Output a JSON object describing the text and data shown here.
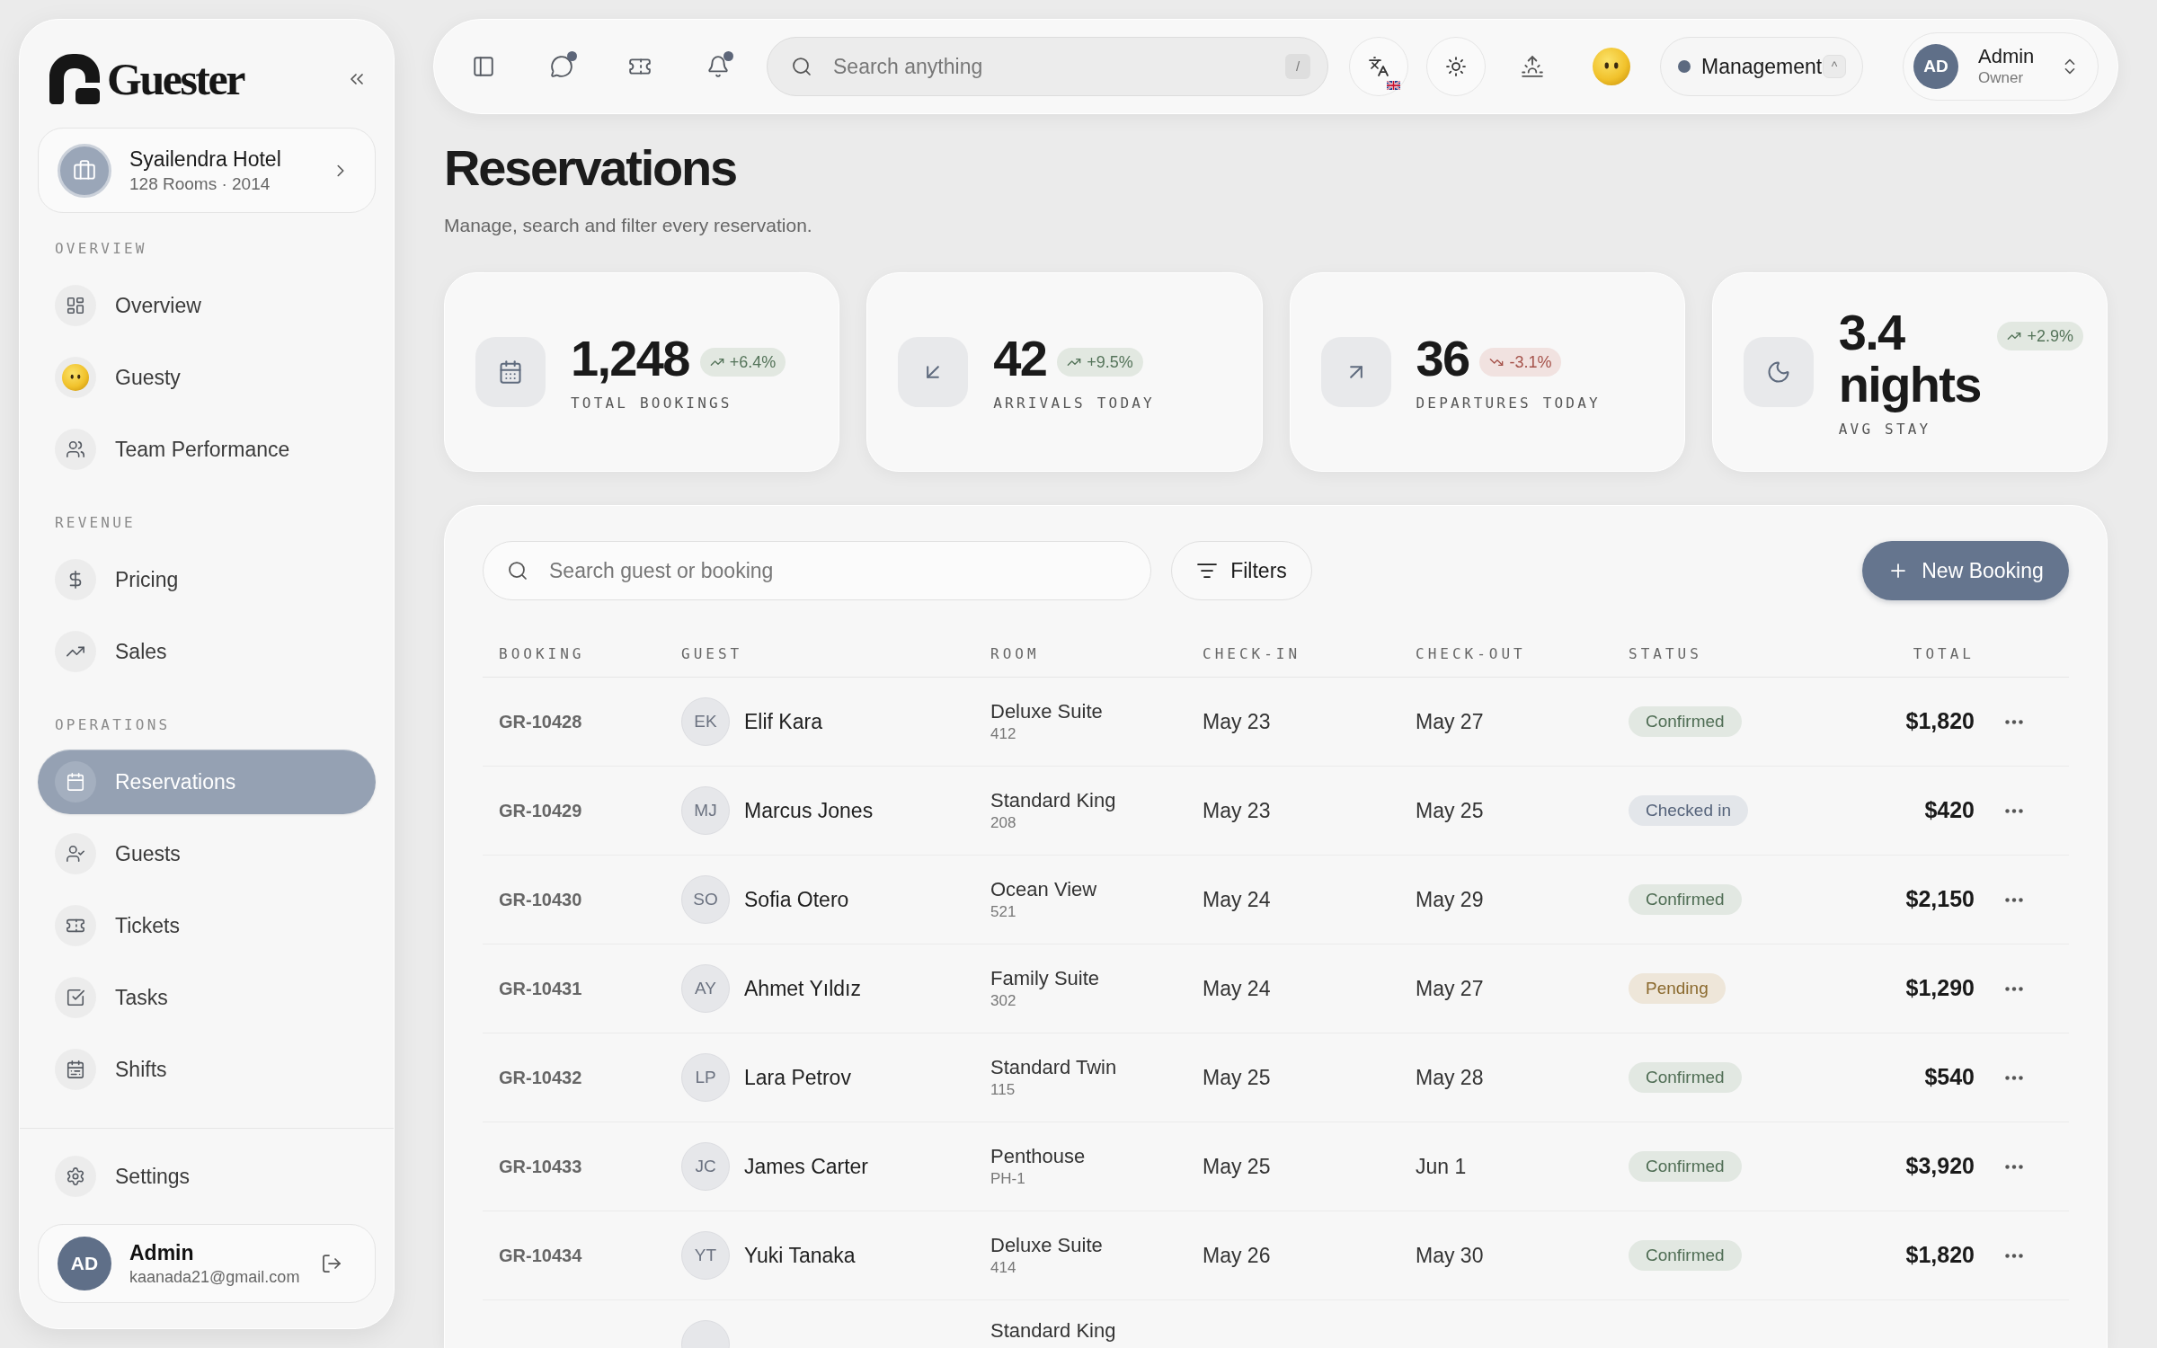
{
  "sidebar": {
    "brand": "Guester",
    "hotel": {
      "name": "Syailendra Hotel",
      "meta": "128 Rooms · 2014"
    },
    "sections": [
      {
        "title": "OVERVIEW",
        "items": [
          {
            "label": "Overview",
            "selected": false
          },
          {
            "label": "Guesty",
            "selected": false
          },
          {
            "label": "Team Performance",
            "selected": false
          }
        ]
      },
      {
        "title": "REVENUE",
        "items": [
          {
            "label": "Pricing",
            "selected": false
          },
          {
            "label": "Sales",
            "selected": false
          }
        ]
      },
      {
        "title": "OPERATIONS",
        "items": [
          {
            "label": "Reservations",
            "selected": true
          },
          {
            "label": "Guests",
            "selected": false
          },
          {
            "label": "Tickets",
            "selected": false
          },
          {
            "label": "Tasks",
            "selected": false
          },
          {
            "label": "Shifts",
            "selected": false
          }
        ]
      }
    ],
    "settings": {
      "label": "Settings",
      "selected": false
    },
    "user": {
      "initials": "AD",
      "name": "Admin",
      "email": "kaanada21@gmail.com"
    }
  },
  "topbar": {
    "toolbar_buttons": [
      {
        "dot": false
      },
      {
        "dot": true
      },
      {
        "dot": false
      },
      {
        "dot": true
      }
    ],
    "search": {
      "placeholder": "Search anything",
      "shortcut": "/"
    },
    "workspace": {
      "label": "Management",
      "shortcut": "^"
    },
    "user": {
      "initials": "AD",
      "name": "Admin",
      "role": "Owner"
    }
  },
  "page": {
    "title": "Reservations",
    "subtitle": "Manage, search and filter every reservation."
  },
  "stats": [
    {
      "value": "1,248",
      "change": "+6.4%",
      "kind": "up",
      "label": "TOTAL BOOKINGS"
    },
    {
      "value": "42",
      "change": "+9.5%",
      "kind": "up",
      "label": "ARRIVALS TODAY"
    },
    {
      "value": "36",
      "change": "-3.1%",
      "kind": "down",
      "label": "DEPARTURES TODAY"
    },
    {
      "value": "3.4 nights",
      "change": "+2.9%",
      "kind": "up",
      "label": "AVG STAY"
    }
  ],
  "table": {
    "search": {
      "placeholder": "Search guest or booking"
    },
    "filters_button": "Filters",
    "new_button": "New Booking",
    "columns": [
      "BOOKING",
      "GUEST",
      "ROOM",
      "CHECK-IN",
      "CHECK-OUT",
      "STATUS",
      "TOTAL"
    ],
    "rows": [
      {
        "booking": "GR-10428",
        "initials": "EK",
        "guest": "Elif Kara",
        "room": "Deluxe Suite",
        "room_number": "412",
        "check_in": "May 23",
        "check_out": "May 27",
        "status": {
          "label": "Confirmed",
          "kind": "confirmed"
        },
        "total": "$1,820"
      },
      {
        "booking": "GR-10429",
        "initials": "MJ",
        "guest": "Marcus Jones",
        "room": "Standard King",
        "room_number": "208",
        "check_in": "May 23",
        "check_out": "May 25",
        "status": {
          "label": "Checked in",
          "kind": "checked_in"
        },
        "total": "$420"
      },
      {
        "booking": "GR-10430",
        "initials": "SO",
        "guest": "Sofia Otero",
        "room": "Ocean View",
        "room_number": "521",
        "check_in": "May 24",
        "check_out": "May 29",
        "status": {
          "label": "Confirmed",
          "kind": "confirmed"
        },
        "total": "$2,150"
      },
      {
        "booking": "GR-10431",
        "initials": "AY",
        "guest": "Ahmet Yıldız",
        "room": "Family Suite",
        "room_number": "302",
        "check_in": "May 24",
        "check_out": "May 27",
        "status": {
          "label": "Pending",
          "kind": "pending"
        },
        "total": "$1,290"
      },
      {
        "booking": "GR-10432",
        "initials": "LP",
        "guest": "Lara Petrov",
        "room": "Standard Twin",
        "room_number": "115",
        "check_in": "May 25",
        "check_out": "May 28",
        "status": {
          "label": "Confirmed",
          "kind": "confirmed"
        },
        "total": "$540"
      },
      {
        "booking": "GR-10433",
        "initials": "JC",
        "guest": "James Carter",
        "room": "Penthouse",
        "room_number": "PH-1",
        "check_in": "May 25",
        "check_out": "Jun 1",
        "status": {
          "label": "Confirmed",
          "kind": "confirmed"
        },
        "total": "$3,920"
      },
      {
        "booking": "GR-10434",
        "initials": "YT",
        "guest": "Yuki Tanaka",
        "room": "Deluxe Suite",
        "room_number": "414",
        "check_in": "May 26",
        "check_out": "May 30",
        "status": {
          "label": "Confirmed",
          "kind": "confirmed"
        },
        "total": "$1,820"
      },
      {
        "room": "Standard King"
      }
    ]
  }
}
